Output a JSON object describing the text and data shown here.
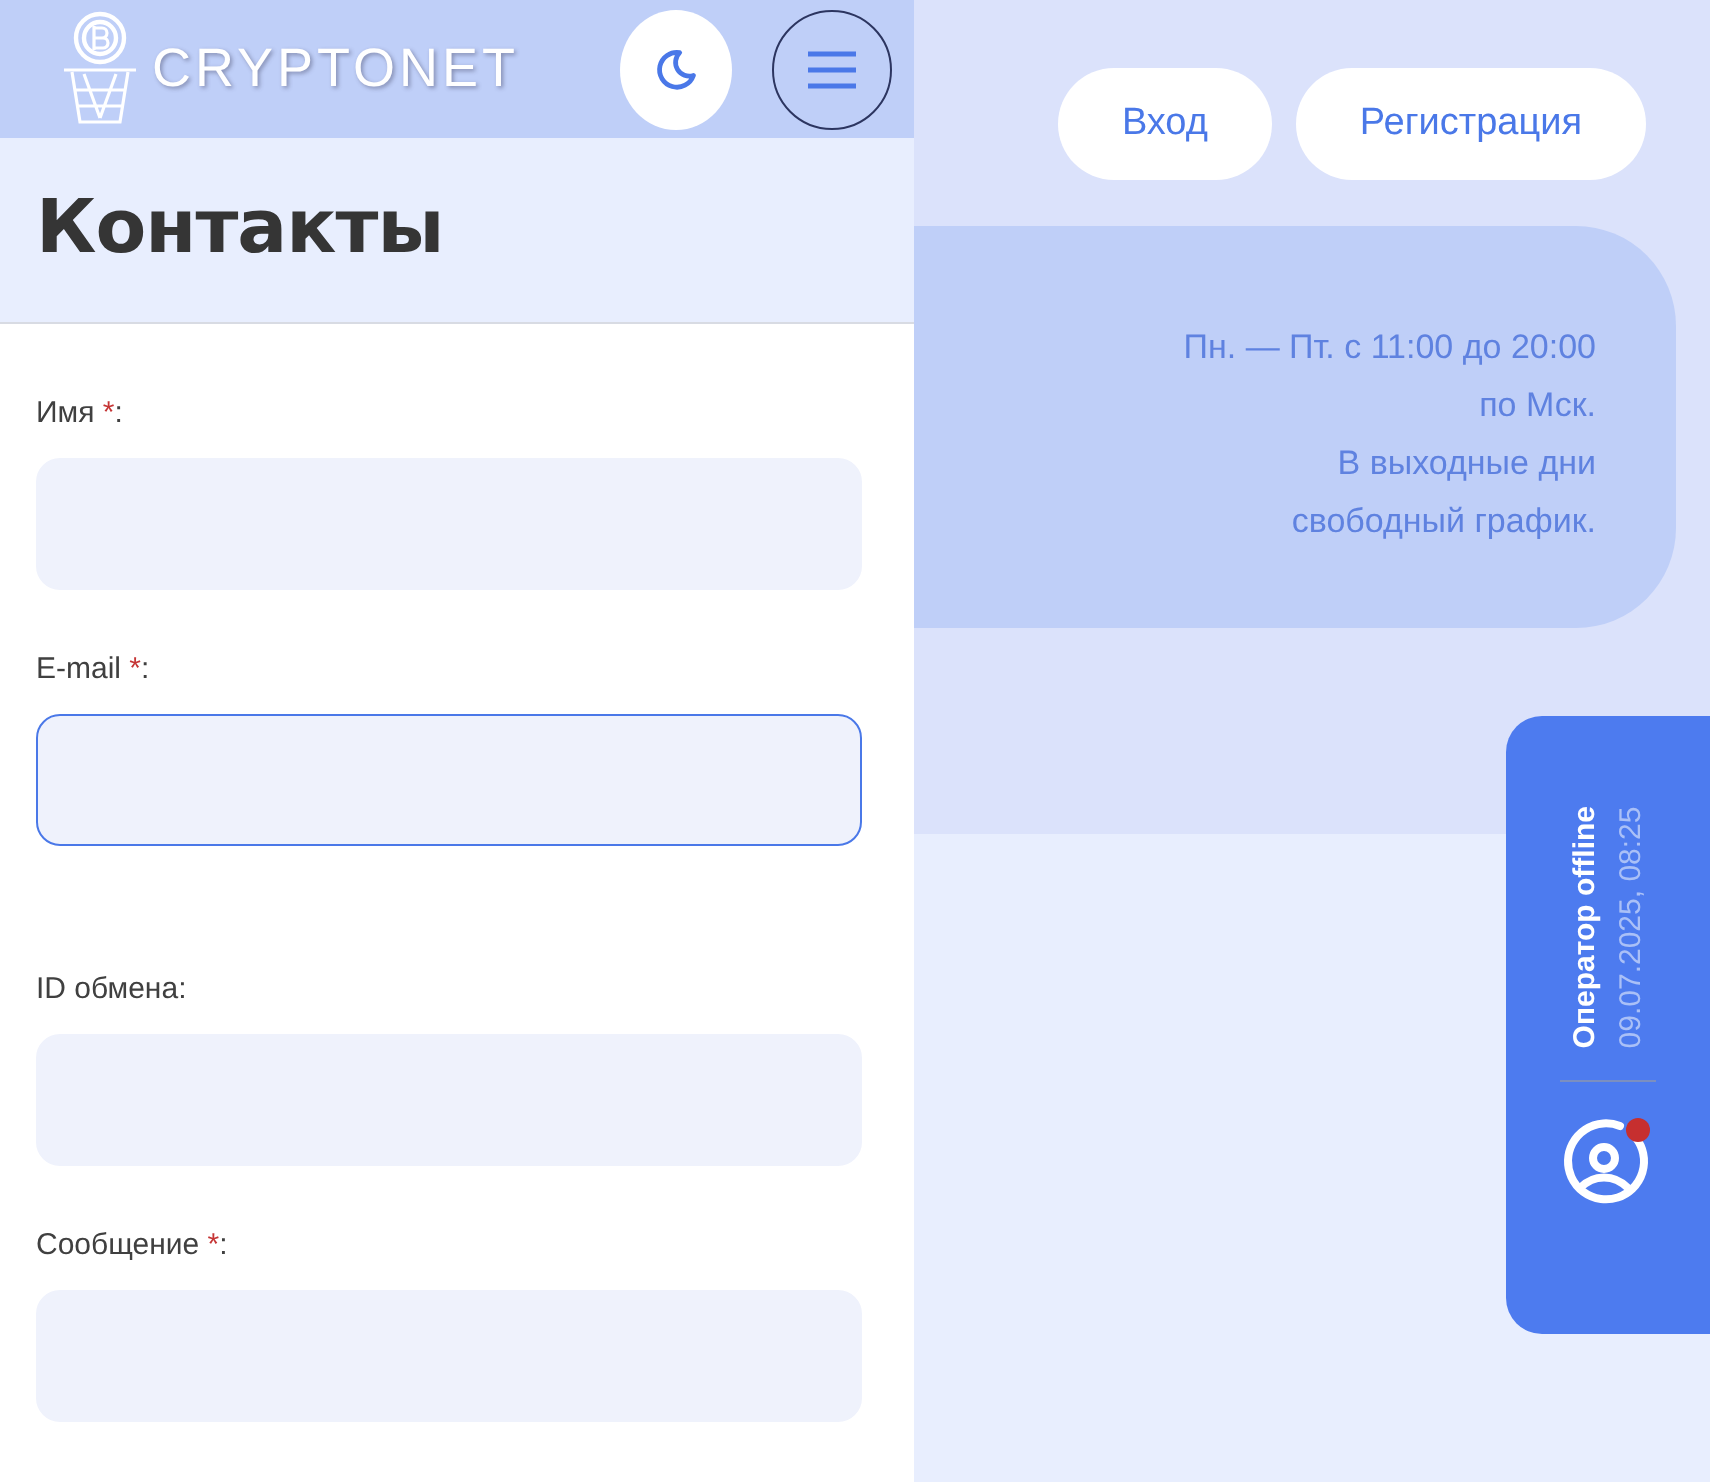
{
  "header": {
    "logo_text": "CRYPTONET"
  },
  "page": {
    "title": "Контакты"
  },
  "form": {
    "fields": [
      {
        "label": "Имя",
        "asterisk": "*",
        "suffix": ":",
        "focused": false
      },
      {
        "label": "E-mail",
        "asterisk": "*",
        "suffix": ":",
        "focused": true
      },
      {
        "label": "ID обмена",
        "suffix": ":",
        "focused": false
      },
      {
        "label": "Сообщение",
        "asterisk": "*",
        "suffix": ":",
        "focused": false
      }
    ]
  },
  "auth_buttons": [
    "Вход",
    "Регистрация"
  ],
  "schedule": [
    "Пн. — Пт. с 11:00 до 20:00",
    "по Мск.",
    "В выходные дни",
    "свободный график."
  ],
  "chat_widget": {
    "status": "Оператор offline",
    "time": "09.07.2025, 08:25",
    "online": false
  }
}
